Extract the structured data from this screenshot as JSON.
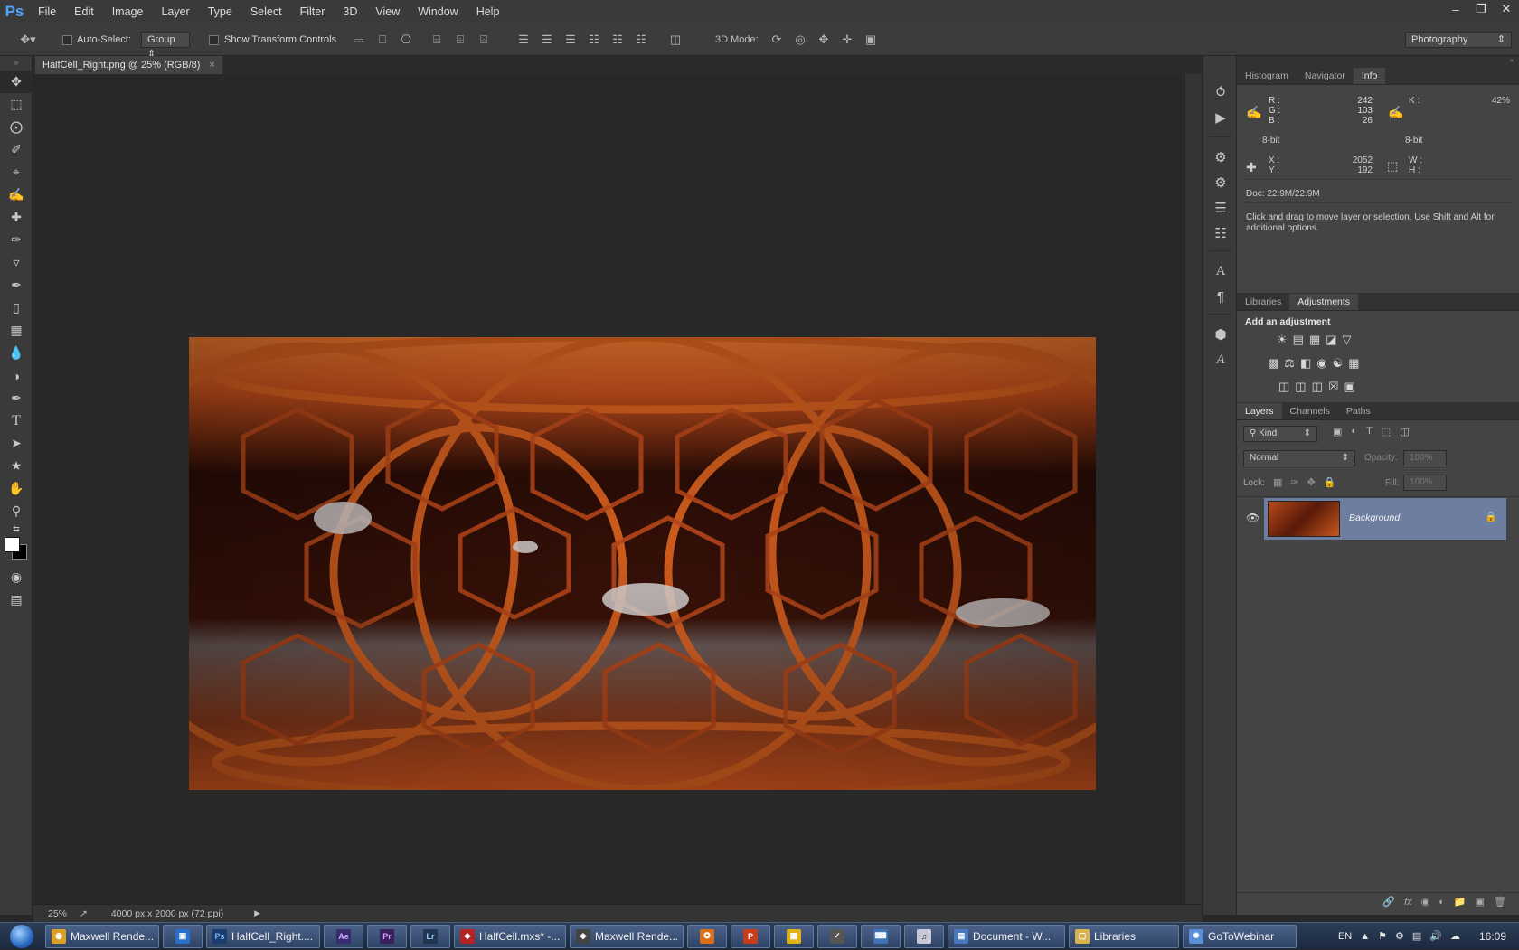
{
  "menubar": {
    "logo": "Ps",
    "items": [
      "File",
      "Edit",
      "Image",
      "Layer",
      "Type",
      "Select",
      "Filter",
      "3D",
      "View",
      "Window",
      "Help"
    ]
  },
  "options": {
    "auto_select_label": "Auto-Select:",
    "auto_select_value": "Group",
    "show_transform_label": "Show Transform Controls",
    "mode_3d_label": "3D Mode:",
    "workspace": "Photography"
  },
  "document": {
    "tab_title": "HalfCell_Right.png @ 25% (RGB/8)",
    "zoom": "25%",
    "doc_size": "4000 px x 2000 px (72 ppi)"
  },
  "info_panel": {
    "tabs": [
      "Histogram",
      "Navigator",
      "Info"
    ],
    "r_label": "R :",
    "r_value": "242",
    "g_label": "G :",
    "g_value": "103",
    "b_label": "B :",
    "b_value": "26",
    "k_label": "K :",
    "k_value": "42%",
    "bit_left": "8-bit",
    "bit_right": "8-bit",
    "x_label": "X :",
    "x_value": "2052",
    "y_label": "Y :",
    "y_value": "192",
    "w_label": "W :",
    "h_label": "H :",
    "doc": "Doc: 22.9M/22.9M",
    "hint": "Click and drag to move layer or selection.  Use Shift and Alt for additional options."
  },
  "adjustments_panel": {
    "tabs": [
      "Libraries",
      "Adjustments"
    ],
    "heading": "Add an adjustment"
  },
  "layers_panel": {
    "tabs": [
      "Layers",
      "Channels",
      "Paths"
    ],
    "filter_kind": "Kind",
    "blend_mode": "Normal",
    "opacity_label": "Opacity:",
    "opacity_value": "100%",
    "lock_label": "Lock:",
    "fill_label": "Fill:",
    "fill_value": "100%",
    "layer_name": "Background"
  },
  "taskbar": {
    "items": [
      {
        "label": "Maxwell Rende...",
        "icon": "chrome-icon",
        "color": "#d9a023"
      },
      {
        "label": "",
        "icon": "app-icon",
        "color": "#2a6fc9"
      },
      {
        "label": "HalfCell_Right....",
        "icon": "ps-icon",
        "color": "#1c3b6e"
      },
      {
        "label": "",
        "icon": "ae-icon",
        "color": "#3a2a6e"
      },
      {
        "label": "",
        "icon": "pr-icon",
        "color": "#3a1f5e"
      },
      {
        "label": "",
        "icon": "lr-icon",
        "color": "#1f3550"
      },
      {
        "label": "HalfCell.mxs* -...",
        "icon": "maxwell-icon",
        "color": "#b52222"
      },
      {
        "label": "Maxwell Rende...",
        "icon": "maxwell-render-icon",
        "color": "#444"
      },
      {
        "label": "",
        "icon": "paint-icon",
        "color": "#d96f1a"
      },
      {
        "label": "",
        "icon": "ppt-icon",
        "color": "#c43e1c"
      },
      {
        "label": "",
        "icon": "app2-icon",
        "color": "#e0b21a"
      },
      {
        "label": "",
        "icon": "app3-icon",
        "color": "#555"
      },
      {
        "label": "",
        "icon": "keyboard-icon",
        "color": "#3e74b5"
      },
      {
        "label": "",
        "icon": "itunes-icon",
        "color": "#c8c8d8"
      },
      {
        "label": "Document - W...",
        "icon": "wordpad-icon",
        "color": "#4a78c0"
      },
      {
        "label": "Libraries",
        "icon": "folder-icon",
        "color": "#d8b24c"
      },
      {
        "label": "GoToWebinar",
        "icon": "gotowebinar-icon",
        "color": "#5b8ed6"
      }
    ],
    "lang": "EN",
    "time": "16:09"
  }
}
